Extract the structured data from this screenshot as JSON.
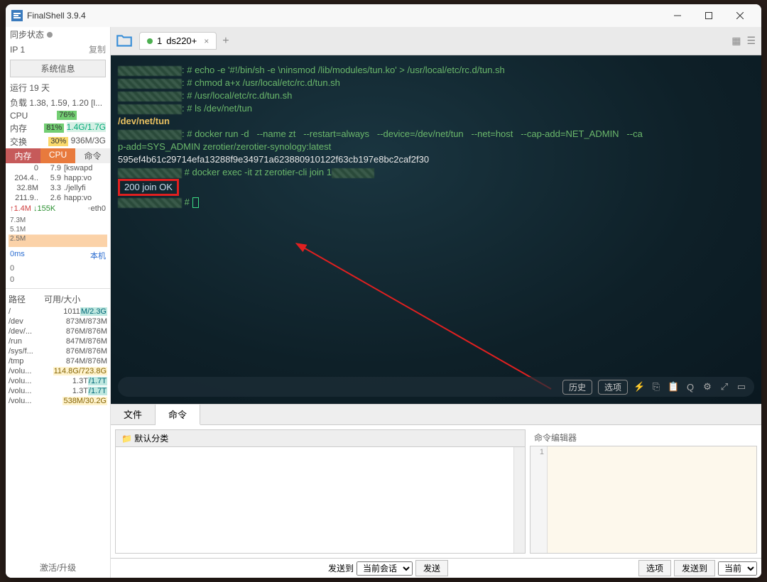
{
  "title": "FinalShell 3.9.4",
  "sidebar": {
    "sync_label": "同步状态",
    "ip_label": "IP 1",
    "copy_label": "复制",
    "sysinfo_btn": "系统信息",
    "uptime": "运行 19 天",
    "load": "负载 1.38, 1.59, 1.20 [l...",
    "cpu_label": "CPU",
    "cpu_pct": "76%",
    "mem_label": "内存",
    "mem_pct": "81%",
    "mem_val": "1.4G/1.7G",
    "swap_label": "交换",
    "swap_pct": "30%",
    "swap_val": "936M/3G",
    "tabs": {
      "mem": "内存",
      "cpu": "CPU",
      "cmd": "命令"
    },
    "procs": [
      {
        "m": "0",
        "c": "7.9",
        "n": "[kswapd"
      },
      {
        "m": "204.4..",
        "c": "5.9",
        "n": "happ:vo"
      },
      {
        "m": "32.8M",
        "c": "3.3",
        "n": "./jellyfi"
      },
      {
        "m": "211.9..",
        "c": "2.6",
        "n": "happ:vo"
      }
    ],
    "net_up": "↑1.4M",
    "net_down": "↓155K",
    "net_if": "eth0",
    "chart_y": [
      "7.3M",
      "5.1M",
      "2.5M"
    ],
    "ping_ms": "0ms",
    "ping_v1": "0",
    "ping_v2": "0",
    "ping_host": "本机",
    "disk_hdr_path": "路径",
    "disk_hdr_avail": "可用/大小",
    "disks": [
      {
        "p": "/",
        "v": "1011M/2.3G",
        "hl": "M/2.3G"
      },
      {
        "p": "/dev",
        "v": "873M/873M"
      },
      {
        "p": "/dev/...",
        "v": "876M/876M"
      },
      {
        "p": "/run",
        "v": "847M/876M"
      },
      {
        "p": "/sys/f...",
        "v": "876M/876M"
      },
      {
        "p": "/tmp",
        "v": "874M/876M"
      },
      {
        "p": "/volu...",
        "v": "114.8G/723.8G",
        "hl2": true
      },
      {
        "p": "/volu...",
        "v": "1.3T/1.7T",
        "hl": "/1.7T"
      },
      {
        "p": "/volu...",
        "v": "1.3T/1.7T",
        "hl": "/1.7T"
      },
      {
        "p": "/volu...",
        "v": "538M/30.2G",
        "hl2": true
      }
    ],
    "activate": "激活/升级"
  },
  "tab": {
    "index": "1",
    "name": "ds220+"
  },
  "terminal": {
    "l1": ": # echo -e '#!/bin/sh -e \\ninsmod /lib/modules/tun.ko' > /usr/local/etc/rc.d/tun.sh",
    "l2": ": # chmod a+x /usr/local/etc/rc.d/tun.sh",
    "l3": ": # /usr/local/etc/rc.d/tun.sh",
    "l4": ": # ls /dev/net/tun",
    "l5": "/dev/net/tun",
    "l6a": ": # docker run -d   --name zt   --restart=always   --device=/dev/net/tun   --net=host   --cap-add=NET_ADMIN   --ca",
    "l6b": "p-add=SYS_ADMIN zerotier/zerotier-synology:latest",
    "l7": "595ef4b61c29714efa13288f9e34971a623880910122f63cb197e8bc2caf2f30",
    "l8": "# docker exec -it zt zerotier-cli join 1",
    "join": "200 join OK",
    "prompt": "#",
    "toolbar": {
      "history": "历史",
      "options": "选项"
    }
  },
  "bottom": {
    "tab_file": "文件",
    "tab_cmd": "命令",
    "default_cat": "默认分类",
    "editor_label": "命令编辑器",
    "line1": "1",
    "send_to": "发送到",
    "current_session": "当前会话",
    "send": "发送",
    "options": "选项",
    "sendto2": "发送到",
    "current2": "当前"
  }
}
